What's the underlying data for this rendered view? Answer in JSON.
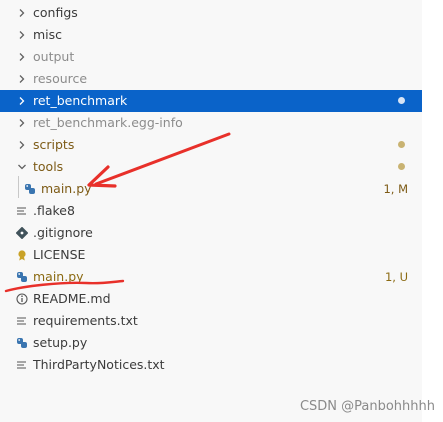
{
  "tree": [
    {
      "label": "configs",
      "kind": "folder",
      "expanded": false,
      "status": "",
      "label_color": "#3b3b3b"
    },
    {
      "label": "misc",
      "kind": "folder",
      "expanded": false,
      "status": "",
      "label_color": "#3b3b3b"
    },
    {
      "label": "output",
      "kind": "folder",
      "expanded": false,
      "status": "",
      "label_color": "#8c8c8c"
    },
    {
      "label": "resource",
      "kind": "folder",
      "expanded": false,
      "status": "",
      "label_color": "#8c8c8c"
    },
    {
      "label": "ret_benchmark",
      "kind": "folder",
      "expanded": false,
      "selected": true,
      "dot_color": "#d7e4f5",
      "status": ""
    },
    {
      "label": "ret_benchmark.egg-info",
      "kind": "folder",
      "expanded": false,
      "status": "",
      "label_color": "#8c8c8c"
    },
    {
      "label": "scripts",
      "kind": "folder",
      "expanded": false,
      "status": "",
      "label_color": "#7d5b16",
      "dot_color": "#c9b372"
    },
    {
      "label": "tools",
      "kind": "folder",
      "expanded": true,
      "status": "",
      "label_color": "#7d5b16",
      "dot_color": "#c9b372"
    },
    {
      "label": "main.py",
      "kind": "python-file",
      "indent": 1,
      "status": "1, M",
      "label_color": "#7d5b16",
      "status_color": "#7d5b16"
    },
    {
      "label": ".flake8",
      "kind": "text-file",
      "status": "",
      "label_color": "#3b3b3b"
    },
    {
      "label": ".gitignore",
      "kind": "git-file",
      "status": "",
      "label_color": "#3b3b3b"
    },
    {
      "label": "LICENSE",
      "kind": "license-file",
      "status": "",
      "label_color": "#3b3b3b"
    },
    {
      "label": "main.py",
      "kind": "python-file",
      "status": "1, U",
      "label_color": "#8b6a12",
      "status_color": "#8b6a12"
    },
    {
      "label": "README.md",
      "kind": "info-file",
      "status": "",
      "label_color": "#3b3b3b"
    },
    {
      "label": "requirements.txt",
      "kind": "text-file",
      "status": "",
      "label_color": "#3b3b3b"
    },
    {
      "label": "setup.py",
      "kind": "python-file",
      "status": "",
      "label_color": "#3b3b3b"
    },
    {
      "label": "ThirdPartyNotices.txt",
      "kind": "text-file",
      "status": "",
      "label_color": "#3b3b3b"
    }
  ],
  "icons": {
    "folder": "chevron-right-icon",
    "python-file": "python-icon",
    "text-file": "lines-icon",
    "git-file": "git-icon",
    "license-file": "license-icon",
    "info-file": "info-icon"
  },
  "colors": {
    "selection": "#0a63c9",
    "annotation": "#e8302a"
  },
  "watermark": "CSDN @Panbohhhhh"
}
